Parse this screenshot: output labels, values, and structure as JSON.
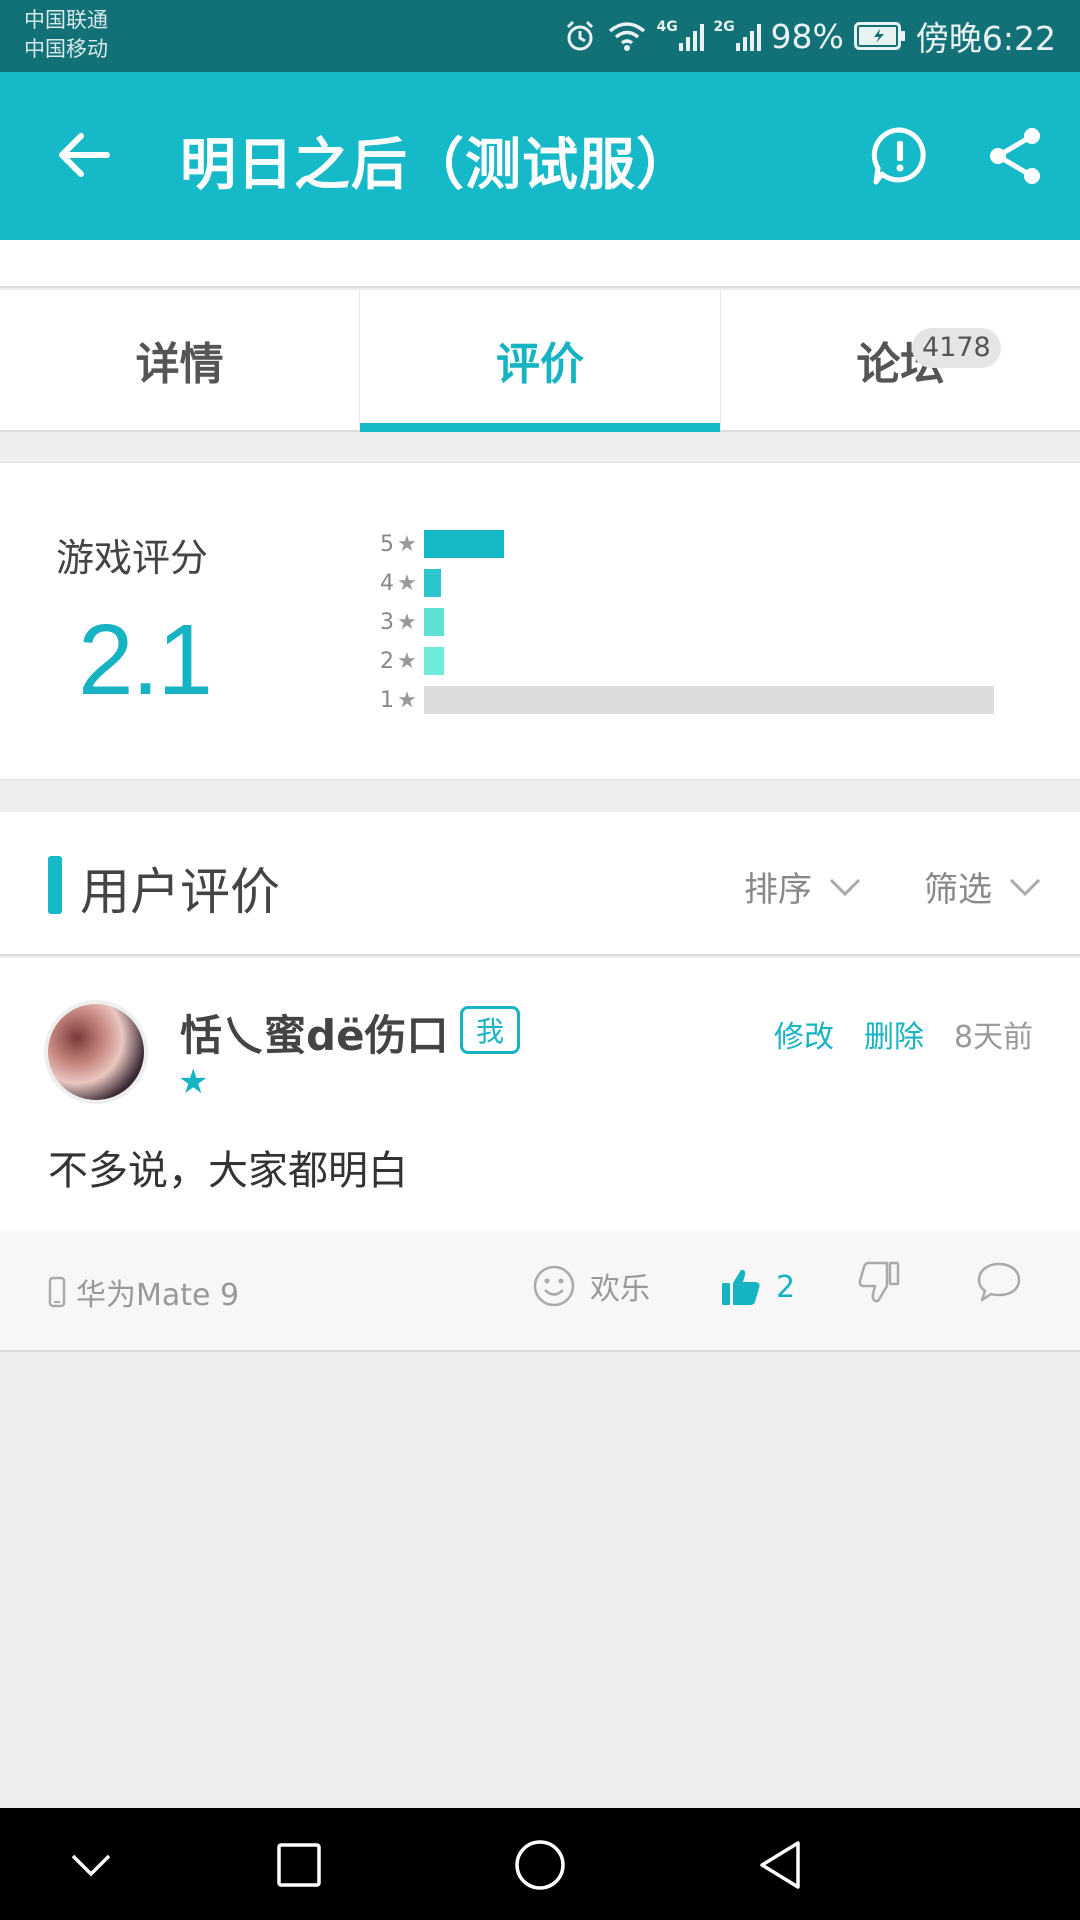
{
  "status_bar": {
    "carrier_1": "中国联通",
    "carrier_2": "中国移动",
    "signal_1_tag": "4G",
    "signal_2_tag": "2G",
    "battery": "98%",
    "time": "傍晚6:22",
    "icons": [
      "alarm-icon",
      "wifi-icon",
      "signal-icon",
      "signal-icon",
      "battery-icon"
    ]
  },
  "header": {
    "title": "明日之后（测试服）",
    "icons": [
      "back-arrow-icon",
      "report-icon",
      "share-icon"
    ],
    "color": "#16b9c7"
  },
  "tabs": [
    {
      "label": "详情",
      "active": false
    },
    {
      "label": "评价",
      "active": true
    },
    {
      "label": "论坛",
      "active": false,
      "badge": "4178"
    }
  ],
  "rating": {
    "label": "游戏评分",
    "score": "2.1",
    "distribution": [
      {
        "stars": "5",
        "fraction": 0.14,
        "color": "#16b9c7"
      },
      {
        "stars": "4",
        "fraction": 0.03,
        "color": "#2bc4cf"
      },
      {
        "stars": "3",
        "fraction": 0.035,
        "color": "#5ee0d3"
      },
      {
        "stars": "2",
        "fraction": 0.035,
        "color": "#6fecd9"
      },
      {
        "stars": "1",
        "fraction": 1.0,
        "color": "#dcdcdc"
      }
    ]
  },
  "reviews_section": {
    "title": "用户评价",
    "sort_label": "排序",
    "filter_label": "筛选"
  },
  "review": {
    "username": "恬乀蜜dë伤口",
    "me_tag": "我",
    "stars": "★",
    "rating_stars": 1,
    "edit_label": "修改",
    "delete_label": "删除",
    "time": "8天前",
    "text": "不多说，大家都明白",
    "device": "华为Mate 9",
    "mood": "欢乐",
    "likes": "2"
  },
  "nav": {
    "icons": [
      "chevron-down-icon",
      "square-icon",
      "circle-home-icon",
      "triangle-back-icon"
    ]
  }
}
